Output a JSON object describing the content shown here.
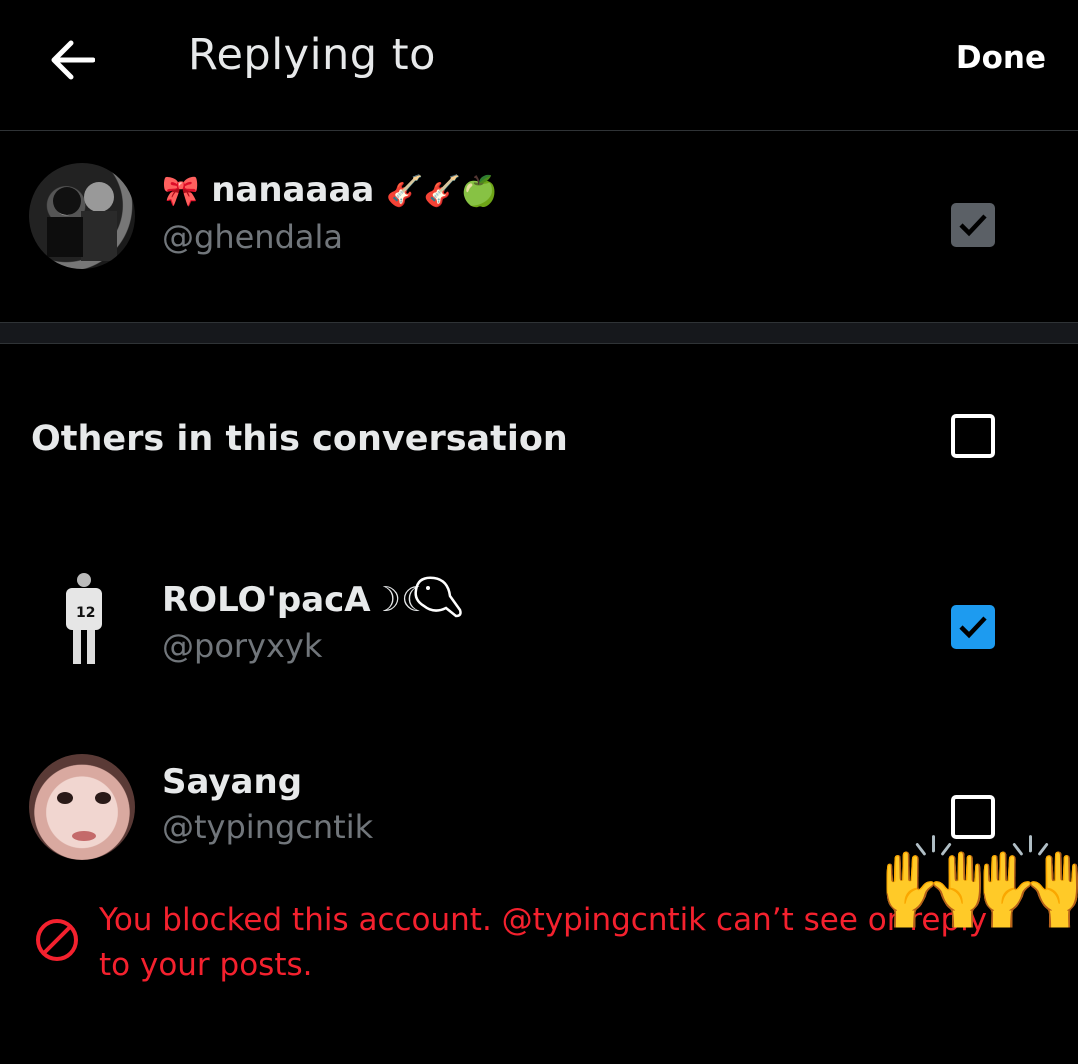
{
  "header": {
    "title": "Replying to",
    "done_label": "Done",
    "back_icon": "arrow-left-icon"
  },
  "primary_user": {
    "prefix_emoji": "🎀",
    "name": "nanaaaa",
    "suffix_emojis": "🎸🎸🍏",
    "handle": "@ghendala",
    "checked": true,
    "checkbox_style": "disabled-gray"
  },
  "others": {
    "label": "Others in this conversation",
    "checked": false
  },
  "users": [
    {
      "name": "ROLO'pacA☽☾",
      "handle": "@poryxyk",
      "checked": true,
      "avatar_icon": "jersey-12-avatar-icon"
    },
    {
      "name": "Sayang",
      "handle": "@typingcntik",
      "checked": false,
      "avatar_icon": "face-avatar-icon"
    }
  ],
  "blocked_notice": {
    "text": "You blocked this account. @typingcntik can’t see or reply to your posts.",
    "icon": "blocked-circle-icon",
    "color": "#f4212e"
  },
  "overlay": {
    "emoji": "🙌🙌"
  },
  "colors": {
    "background": "#000000",
    "accent": "#1d9bf0",
    "muted_text": "#71767b",
    "error": "#f4212e"
  }
}
